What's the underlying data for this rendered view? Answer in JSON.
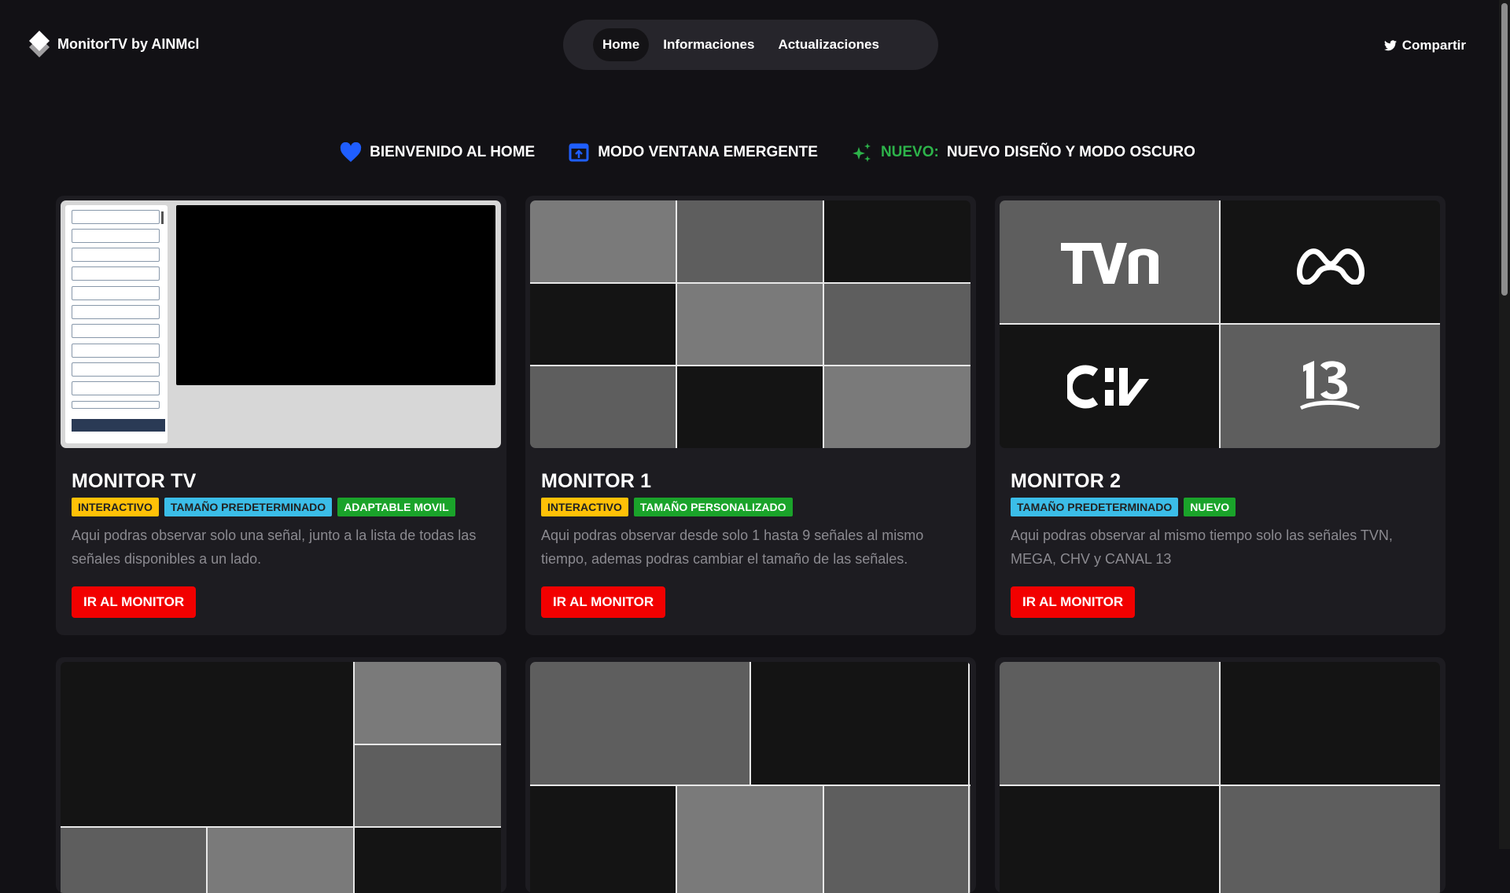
{
  "header": {
    "brand": "MonitorTV by AINMcl",
    "nav": [
      {
        "label": "Home",
        "active": true
      },
      {
        "label": "Informaciones",
        "active": false
      },
      {
        "label": "Actualizaciones",
        "active": false
      }
    ],
    "share_label": "Compartir"
  },
  "announcements": {
    "welcome": "BIENVENIDO AL HOME",
    "popup": "MODO VENTANA EMERGENTE",
    "new_prefix": "NUEVO:",
    "new_text": "NUEVO DISEÑO Y MODO OSCURO"
  },
  "cards": [
    {
      "title": "MONITOR TV",
      "tags": [
        {
          "label": "INTERACTIVO",
          "color": "#ffc107"
        },
        {
          "label": "TAMAÑO PREDETERMINADO",
          "color": "#3bbde8"
        },
        {
          "label": "ADAPTABLE MOVIL",
          "color": "#1aa32a"
        }
      ],
      "description": "Aqui podras observar solo una señal, junto a la lista de todas las señales disponibles a un lado.",
      "button": "IR AL MONITOR"
    },
    {
      "title": "MONITOR 1",
      "tags": [
        {
          "label": "INTERACTIVO",
          "color": "#ffc107"
        },
        {
          "label": "TAMAÑO PERSONALIZADO",
          "color": "#1aa32a"
        }
      ],
      "description": "Aqui podras observar desde solo 1 hasta 9 señales al mismo tiempo, ademas podras cambiar el tamaño de las señales.",
      "button": "IR AL MONITOR"
    },
    {
      "title": "MONITOR 2",
      "tags": [
        {
          "label": "TAMAÑO PREDETERMINADO",
          "color": "#3bbde8"
        },
        {
          "label": "NUEVO",
          "color": "#1aa32a"
        }
      ],
      "description": "Aqui podras observar al mismo tiempo solo las señales TVN, MEGA, CHV y CANAL 13",
      "button": "IR AL MONITOR"
    }
  ],
  "channel_logos": [
    "tvn-logo",
    "mega-logo",
    "chv-logo",
    "canal13-logo"
  ],
  "colors": {
    "background": "#121115",
    "card": "#1d1c21",
    "accent_red": "#f20000",
    "heart_blue": "#1f5eff",
    "new_green": "#2db34a"
  }
}
